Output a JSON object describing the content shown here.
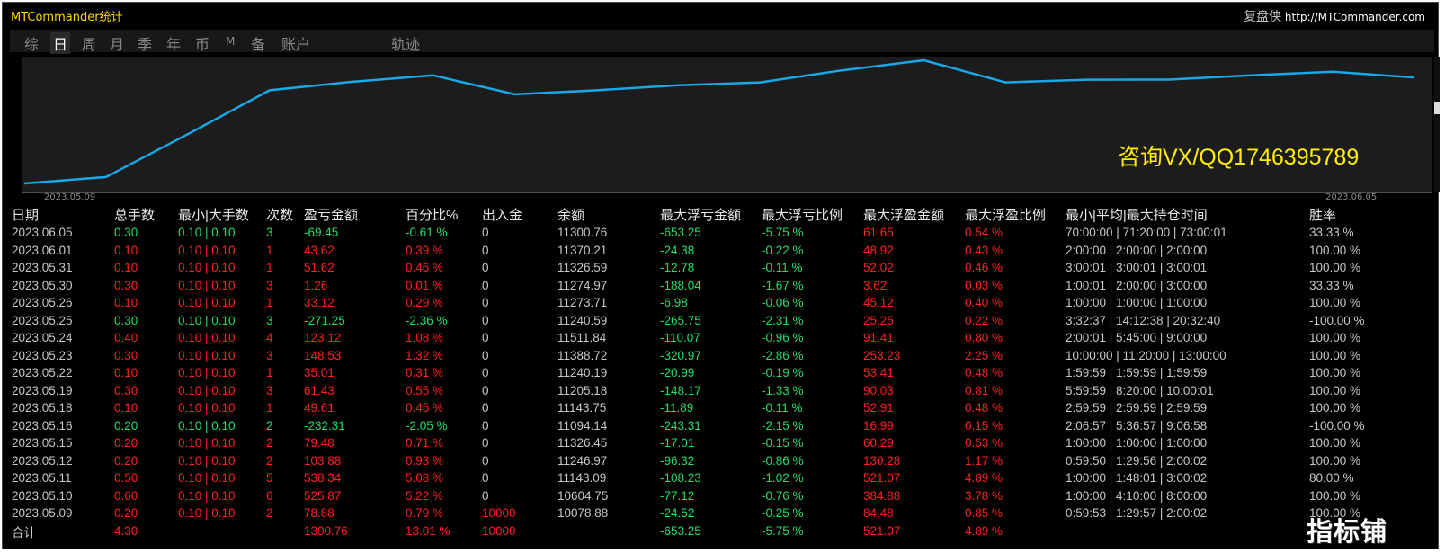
{
  "header": {
    "title": "MTCommander统计",
    "right_label": "复盘侠",
    "right_url": "http://MTCommander.com"
  },
  "tabs": [
    {
      "label": "综"
    },
    {
      "label": "日"
    },
    {
      "label": "周"
    },
    {
      "label": "月"
    },
    {
      "label": "季"
    },
    {
      "label": "年"
    },
    {
      "label": "币"
    },
    {
      "label": "M"
    },
    {
      "label": "备"
    },
    {
      "label": "账户"
    },
    {
      "label": "轨迹"
    }
  ],
  "active_tab": "日",
  "chart": {
    "x_start_label": "2023.05.09",
    "x_end_label": "2023.06.05",
    "line_color": "#1aa7e8",
    "balance_series": [
      10000,
      10078.88,
      10604.75,
      11143.09,
      11246.97,
      11326.45,
      11094.14,
      11143.75,
      11205.18,
      11240.19,
      11388.72,
      11511.84,
      11240.59,
      11273.71,
      11274.97,
      11326.59,
      11370.21,
      11300.76
    ]
  },
  "watermark": "咨询VX/QQ1746395789",
  "bottom_logo": "指标铺",
  "table": {
    "columns": [
      "日期",
      "总手数",
      "最小|大手数",
      "次数",
      "盈亏金额",
      "百分比%",
      "出入金",
      "余额",
      "最大浮亏金额",
      "最大浮亏比例",
      "最大浮盈金额",
      "最大浮盈比例",
      "最小|平均|最大持仓时间",
      "胜率"
    ],
    "rows": [
      {
        "date": "2023.06.05",
        "lots": "0.30",
        "minmax": "0.10 | 0.10",
        "count": "3",
        "pnl": "-69.45",
        "pct": "-0.61 %",
        "flow": "0",
        "balance": "11300.76",
        "maxloss": "-653.25",
        "maxlosspct": "-5.75 %",
        "maxprofit": "61.65",
        "maxprofitpct": "0.54 %",
        "hold": "70:00:00 | 71:20:00 | 73:00:01",
        "win": "33.33 %",
        "sign": "neg"
      },
      {
        "date": "2023.06.01",
        "lots": "0.10",
        "minmax": "0.10 | 0.10",
        "count": "1",
        "pnl": "43.62",
        "pct": "0.39 %",
        "flow": "0",
        "balance": "11370.21",
        "maxloss": "-24.38",
        "maxlosspct": "-0.22 %",
        "maxprofit": "48.92",
        "maxprofitpct": "0.43 %",
        "hold": "2:00:00 | 2:00:00 | 2:00:00",
        "win": "100.00 %",
        "sign": "pos"
      },
      {
        "date": "2023.05.31",
        "lots": "0.10",
        "minmax": "0.10 | 0.10",
        "count": "1",
        "pnl": "51.62",
        "pct": "0.46 %",
        "flow": "0",
        "balance": "11326.59",
        "maxloss": "-12.78",
        "maxlosspct": "-0.11 %",
        "maxprofit": "52.02",
        "maxprofitpct": "0.46 %",
        "hold": "3:00:01 | 3:00:01 | 3:00:01",
        "win": "100.00 %",
        "sign": "pos"
      },
      {
        "date": "2023.05.30",
        "lots": "0.30",
        "minmax": "0.10 | 0.10",
        "count": "3",
        "pnl": "1.26",
        "pct": "0.01 %",
        "flow": "0",
        "balance": "11274.97",
        "maxloss": "-188.04",
        "maxlosspct": "-1.67 %",
        "maxprofit": "3.62",
        "maxprofitpct": "0.03 %",
        "hold": "1:00:01 | 2:00:00 | 3:00:00",
        "win": "33.33 %",
        "sign": "pos"
      },
      {
        "date": "2023.05.26",
        "lots": "0.10",
        "minmax": "0.10 | 0.10",
        "count": "1",
        "pnl": "33.12",
        "pct": "0.29 %",
        "flow": "0",
        "balance": "11273.71",
        "maxloss": "-6.98",
        "maxlosspct": "-0.06 %",
        "maxprofit": "45.12",
        "maxprofitpct": "0.40 %",
        "hold": "1:00:00 | 1:00:00 | 1:00:00",
        "win": "100.00 %",
        "sign": "pos"
      },
      {
        "date": "2023.05.25",
        "lots": "0.30",
        "minmax": "0.10 | 0.10",
        "count": "3",
        "pnl": "-271.25",
        "pct": "-2.36 %",
        "flow": "0",
        "balance": "11240.59",
        "maxloss": "-265.75",
        "maxlosspct": "-2.31 %",
        "maxprofit": "25.25",
        "maxprofitpct": "0.22 %",
        "hold": "3:32:37 | 14:12:38 | 20:32:40",
        "win": "-100.00 %",
        "sign": "neg"
      },
      {
        "date": "2023.05.24",
        "lots": "0.40",
        "minmax": "0.10 | 0.10",
        "count": "4",
        "pnl": "123.12",
        "pct": "1.08 %",
        "flow": "0",
        "balance": "11511.84",
        "maxloss": "-110.07",
        "maxlosspct": "-0.96 %",
        "maxprofit": "91.41",
        "maxprofitpct": "0.80 %",
        "hold": "2:00:01 | 5:45:00 | 9:00:00",
        "win": "100.00 %",
        "sign": "pos"
      },
      {
        "date": "2023.05.23",
        "lots": "0.30",
        "minmax": "0.10 | 0.10",
        "count": "3",
        "pnl": "148.53",
        "pct": "1.32 %",
        "flow": "0",
        "balance": "11388.72",
        "maxloss": "-320.97",
        "maxlosspct": "-2.86 %",
        "maxprofit": "253.23",
        "maxprofitpct": "2.25 %",
        "hold": "10:00:00 | 11:20:00 | 13:00:00",
        "win": "100.00 %",
        "sign": "pos"
      },
      {
        "date": "2023.05.22",
        "lots": "0.10",
        "minmax": "0.10 | 0.10",
        "count": "1",
        "pnl": "35.01",
        "pct": "0.31 %",
        "flow": "0",
        "balance": "11240.19",
        "maxloss": "-20.99",
        "maxlosspct": "-0.19 %",
        "maxprofit": "53.41",
        "maxprofitpct": "0.48 %",
        "hold": "1:59:59 | 1:59:59 | 1:59:59",
        "win": "100.00 %",
        "sign": "pos"
      },
      {
        "date": "2023.05.19",
        "lots": "0.30",
        "minmax": "0.10 | 0.10",
        "count": "3",
        "pnl": "61.43",
        "pct": "0.55 %",
        "flow": "0",
        "balance": "11205.18",
        "maxloss": "-148.17",
        "maxlosspct": "-1.33 %",
        "maxprofit": "90.03",
        "maxprofitpct": "0.81 %",
        "hold": "5:59:59 | 8:20:00 | 10:00:01",
        "win": "100.00 %",
        "sign": "pos"
      },
      {
        "date": "2023.05.18",
        "lots": "0.10",
        "minmax": "0.10 | 0.10",
        "count": "1",
        "pnl": "49.61",
        "pct": "0.45 %",
        "flow": "0",
        "balance": "11143.75",
        "maxloss": "-11.89",
        "maxlosspct": "-0.11 %",
        "maxprofit": "52.91",
        "maxprofitpct": "0.48 %",
        "hold": "2:59:59 | 2:59:59 | 2:59:59",
        "win": "100.00 %",
        "sign": "pos"
      },
      {
        "date": "2023.05.16",
        "lots": "0.20",
        "minmax": "0.10 | 0.10",
        "count": "2",
        "pnl": "-232.31",
        "pct": "-2.05 %",
        "flow": "0",
        "balance": "11094.14",
        "maxloss": "-243.31",
        "maxlosspct": "-2.15 %",
        "maxprofit": "16.99",
        "maxprofitpct": "0.15 %",
        "hold": "2:06:57 | 5:36:57 | 9:06:58",
        "win": "-100.00 %",
        "sign": "neg"
      },
      {
        "date": "2023.05.15",
        "lots": "0.20",
        "minmax": "0.10 | 0.10",
        "count": "2",
        "pnl": "79.48",
        "pct": "0.71 %",
        "flow": "0",
        "balance": "11326.45",
        "maxloss": "-17.01",
        "maxlosspct": "-0.15 %",
        "maxprofit": "60.29",
        "maxprofitpct": "0.53 %",
        "hold": "1:00:00 | 1:00:00 | 1:00:00",
        "win": "100.00 %",
        "sign": "pos"
      },
      {
        "date": "2023.05.12",
        "lots": "0.20",
        "minmax": "0.10 | 0.10",
        "count": "2",
        "pnl": "103.88",
        "pct": "0.93 %",
        "flow": "0",
        "balance": "11246.97",
        "maxloss": "-96.32",
        "maxlosspct": "-0.86 %",
        "maxprofit": "130.28",
        "maxprofitpct": "1.17 %",
        "hold": "0:59:50 | 1:29:56 | 2:00:02",
        "win": "100.00 %",
        "sign": "pos"
      },
      {
        "date": "2023.05.11",
        "lots": "0.50",
        "minmax": "0.10 | 0.10",
        "count": "5",
        "pnl": "538.34",
        "pct": "5.08 %",
        "flow": "0",
        "balance": "11143.09",
        "maxloss": "-108.23",
        "maxlosspct": "-1.02 %",
        "maxprofit": "521.07",
        "maxprofitpct": "4.89 %",
        "hold": "1:00:00 | 1:48:01 | 3:00:02",
        "win": "80.00 %",
        "sign": "pos"
      },
      {
        "date": "2023.05.10",
        "lots": "0.60",
        "minmax": "0.10 | 0.10",
        "count": "6",
        "pnl": "525.87",
        "pct": "5.22 %",
        "flow": "0",
        "balance": "10604.75",
        "maxloss": "-77.12",
        "maxlosspct": "-0.76 %",
        "maxprofit": "384.88",
        "maxprofitpct": "3.78 %",
        "hold": "1:00:00 | 4:10:00 | 8:00:00",
        "win": "100.00 %",
        "sign": "pos"
      },
      {
        "date": "2023.05.09",
        "lots": "0.20",
        "minmax": "0.10 | 0.10",
        "count": "2",
        "pnl": "78.88",
        "pct": "0.79 %",
        "flow": "10000",
        "balance": "10078.88",
        "maxloss": "-24.52",
        "maxlosspct": "-0.25 %",
        "maxprofit": "84.48",
        "maxprofitpct": "0.85 %",
        "hold": "0:59:53 | 1:29:57 | 2:00:02",
        "win": "100.00 %",
        "sign": "pos"
      }
    ],
    "total": {
      "label": "合计",
      "lots": "4.30",
      "pnl": "1300.76",
      "pct": "13.01 %",
      "flow": "10000",
      "maxloss": "-653.25",
      "maxlosspct": "-5.75 %",
      "maxprofit": "521.07",
      "maxprofitpct": "4.89 %"
    }
  },
  "colors": {
    "positive": "#ff2020",
    "negative": "#22dd66",
    "title": "#ffd700",
    "watermark": "#ffee00",
    "background": "#000000"
  }
}
